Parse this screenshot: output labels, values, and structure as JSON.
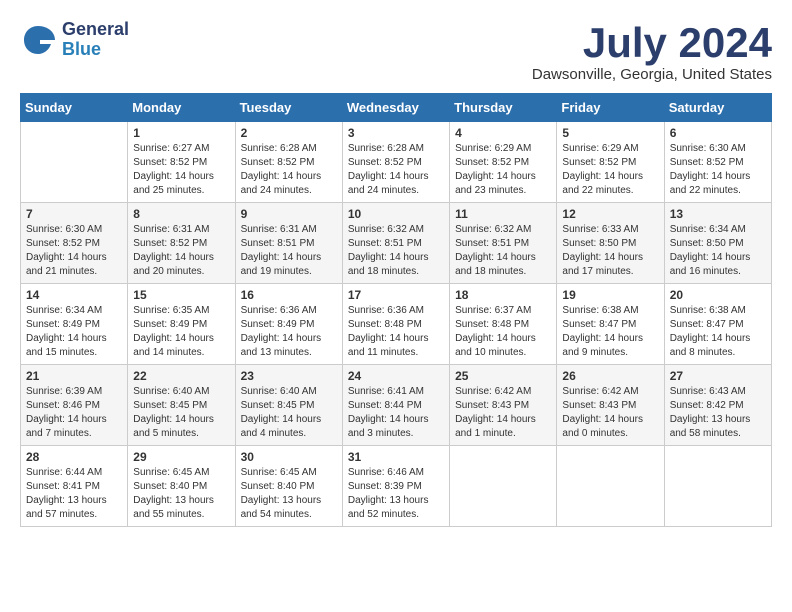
{
  "header": {
    "logo": {
      "general": "General",
      "blue": "Blue"
    },
    "title": "July 2024",
    "location": "Dawsonville, Georgia, United States"
  },
  "weekdays": [
    "Sunday",
    "Monday",
    "Tuesday",
    "Wednesday",
    "Thursday",
    "Friday",
    "Saturday"
  ],
  "weeks": [
    [
      {
        "day": null,
        "info": null
      },
      {
        "day": "1",
        "info": "Sunrise: 6:27 AM\nSunset: 8:52 PM\nDaylight: 14 hours\nand 25 minutes."
      },
      {
        "day": "2",
        "info": "Sunrise: 6:28 AM\nSunset: 8:52 PM\nDaylight: 14 hours\nand 24 minutes."
      },
      {
        "day": "3",
        "info": "Sunrise: 6:28 AM\nSunset: 8:52 PM\nDaylight: 14 hours\nand 24 minutes."
      },
      {
        "day": "4",
        "info": "Sunrise: 6:29 AM\nSunset: 8:52 PM\nDaylight: 14 hours\nand 23 minutes."
      },
      {
        "day": "5",
        "info": "Sunrise: 6:29 AM\nSunset: 8:52 PM\nDaylight: 14 hours\nand 22 minutes."
      },
      {
        "day": "6",
        "info": "Sunrise: 6:30 AM\nSunset: 8:52 PM\nDaylight: 14 hours\nand 22 minutes."
      }
    ],
    [
      {
        "day": "7",
        "info": "Sunrise: 6:30 AM\nSunset: 8:52 PM\nDaylight: 14 hours\nand 21 minutes."
      },
      {
        "day": "8",
        "info": "Sunrise: 6:31 AM\nSunset: 8:52 PM\nDaylight: 14 hours\nand 20 minutes."
      },
      {
        "day": "9",
        "info": "Sunrise: 6:31 AM\nSunset: 8:51 PM\nDaylight: 14 hours\nand 19 minutes."
      },
      {
        "day": "10",
        "info": "Sunrise: 6:32 AM\nSunset: 8:51 PM\nDaylight: 14 hours\nand 18 minutes."
      },
      {
        "day": "11",
        "info": "Sunrise: 6:32 AM\nSunset: 8:51 PM\nDaylight: 14 hours\nand 18 minutes."
      },
      {
        "day": "12",
        "info": "Sunrise: 6:33 AM\nSunset: 8:50 PM\nDaylight: 14 hours\nand 17 minutes."
      },
      {
        "day": "13",
        "info": "Sunrise: 6:34 AM\nSunset: 8:50 PM\nDaylight: 14 hours\nand 16 minutes."
      }
    ],
    [
      {
        "day": "14",
        "info": "Sunrise: 6:34 AM\nSunset: 8:49 PM\nDaylight: 14 hours\nand 15 minutes."
      },
      {
        "day": "15",
        "info": "Sunrise: 6:35 AM\nSunset: 8:49 PM\nDaylight: 14 hours\nand 14 minutes."
      },
      {
        "day": "16",
        "info": "Sunrise: 6:36 AM\nSunset: 8:49 PM\nDaylight: 14 hours\nand 13 minutes."
      },
      {
        "day": "17",
        "info": "Sunrise: 6:36 AM\nSunset: 8:48 PM\nDaylight: 14 hours\nand 11 minutes."
      },
      {
        "day": "18",
        "info": "Sunrise: 6:37 AM\nSunset: 8:48 PM\nDaylight: 14 hours\nand 10 minutes."
      },
      {
        "day": "19",
        "info": "Sunrise: 6:38 AM\nSunset: 8:47 PM\nDaylight: 14 hours\nand 9 minutes."
      },
      {
        "day": "20",
        "info": "Sunrise: 6:38 AM\nSunset: 8:47 PM\nDaylight: 14 hours\nand 8 minutes."
      }
    ],
    [
      {
        "day": "21",
        "info": "Sunrise: 6:39 AM\nSunset: 8:46 PM\nDaylight: 14 hours\nand 7 minutes."
      },
      {
        "day": "22",
        "info": "Sunrise: 6:40 AM\nSunset: 8:45 PM\nDaylight: 14 hours\nand 5 minutes."
      },
      {
        "day": "23",
        "info": "Sunrise: 6:40 AM\nSunset: 8:45 PM\nDaylight: 14 hours\nand 4 minutes."
      },
      {
        "day": "24",
        "info": "Sunrise: 6:41 AM\nSunset: 8:44 PM\nDaylight: 14 hours\nand 3 minutes."
      },
      {
        "day": "25",
        "info": "Sunrise: 6:42 AM\nSunset: 8:43 PM\nDaylight: 14 hours\nand 1 minute."
      },
      {
        "day": "26",
        "info": "Sunrise: 6:42 AM\nSunset: 8:43 PM\nDaylight: 14 hours\nand 0 minutes."
      },
      {
        "day": "27",
        "info": "Sunrise: 6:43 AM\nSunset: 8:42 PM\nDaylight: 13 hours\nand 58 minutes."
      }
    ],
    [
      {
        "day": "28",
        "info": "Sunrise: 6:44 AM\nSunset: 8:41 PM\nDaylight: 13 hours\nand 57 minutes."
      },
      {
        "day": "29",
        "info": "Sunrise: 6:45 AM\nSunset: 8:40 PM\nDaylight: 13 hours\nand 55 minutes."
      },
      {
        "day": "30",
        "info": "Sunrise: 6:45 AM\nSunset: 8:40 PM\nDaylight: 13 hours\nand 54 minutes."
      },
      {
        "day": "31",
        "info": "Sunrise: 6:46 AM\nSunset: 8:39 PM\nDaylight: 13 hours\nand 52 minutes."
      },
      {
        "day": null,
        "info": null
      },
      {
        "day": null,
        "info": null
      },
      {
        "day": null,
        "info": null
      }
    ]
  ]
}
